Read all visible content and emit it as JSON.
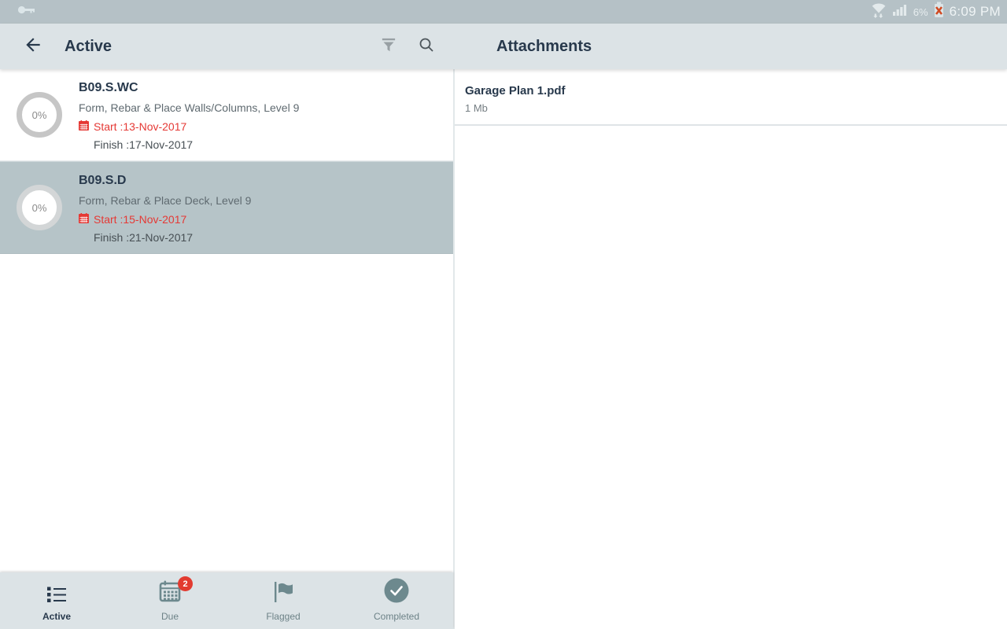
{
  "status_bar": {
    "time": "6:09 PM",
    "battery_percent": "6%",
    "icons": [
      "key-icon",
      "wifi-icon",
      "signal-strength-icon",
      "battery-dead-icon"
    ]
  },
  "app_bar": {
    "left_title": "Active",
    "right_title": "Attachments",
    "icons": [
      "back-arrow-icon",
      "filter-icon",
      "search-icon"
    ]
  },
  "task_list": {
    "items": [
      {
        "progress": "0%",
        "code": "B09.S.WC",
        "description": "Form, Rebar & Place Walls/Columns, Level 9",
        "start_label": "Start :13-Nov-2017",
        "finish_label": "Finish :17-Nov-2017",
        "selected": false
      },
      {
        "progress": "0%",
        "code": "B09.S.D",
        "description": "Form, Rebar & Place Deck, Level 9",
        "start_label": "Start :15-Nov-2017",
        "finish_label": "Finish :21-Nov-2017",
        "selected": true
      }
    ]
  },
  "attachments": {
    "items": [
      {
        "name": "Garage Plan 1.pdf",
        "size": "1 Mb"
      }
    ]
  },
  "bottom_nav": {
    "tabs": [
      {
        "label": "Active",
        "icon": "list-icon",
        "active": true
      },
      {
        "label": "Due",
        "icon": "calendar-icon",
        "badge": "2",
        "active": false
      },
      {
        "label": "Flagged",
        "icon": "flag-icon",
        "active": false
      },
      {
        "label": "Completed",
        "icon": "check-circle-icon",
        "active": false
      }
    ]
  },
  "colors": {
    "status_bar_bg": "#b5c1c6",
    "app_bar_bg": "#dce3e6",
    "selected_row_bg": "#b6c4c8",
    "primary_text": "#28394c",
    "accent_red": "#e53935",
    "nav_icon_teal": "#6d898e",
    "badge_red": "#e23b30"
  }
}
